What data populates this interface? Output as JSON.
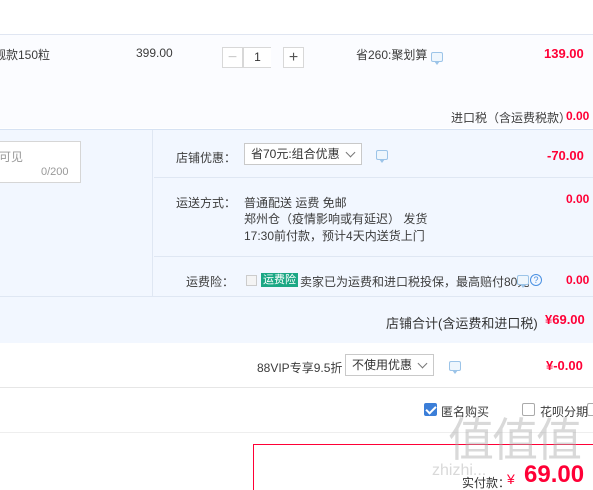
{
  "item": {
    "title_partial": "靓款150粒",
    "unit_price": "399.00",
    "quantity": "1",
    "minus_label": "−",
    "plus_label": "+",
    "savings": "省260:聚划算",
    "subtotal": "139.00",
    "import_tax_label": "进口税（含运费税款）",
    "import_tax_value": "0.00"
  },
  "memo": {
    "placeholder_partial": "可见",
    "counter": "0/200"
  },
  "store": {
    "discount_label": "店铺优惠：",
    "discount_select": "省70元:组合优惠",
    "discount_value": "-70.00",
    "shipping_label": "运送方式：",
    "shipping_line1": "普通配送 运费 免邮",
    "shipping_line2": "郑州仓（疫情影响或有延迟）  发货",
    "shipping_line3": "17:30前付款，预计4天内送货上门",
    "shipping_value": "0.00",
    "insurance_label": "运费险：",
    "insurance_badge": "运费险",
    "insurance_text": "卖家已为运费和进口税投保，最高赔付80元",
    "insurance_value": "0.00",
    "total_label": "店铺合计(含运费和进口税)",
    "total_value": "¥69.00"
  },
  "vip": {
    "label": "88VIP专享9.5折",
    "select": "不使用优惠",
    "value": "¥-0.00"
  },
  "options": {
    "anonymous": "匿名购买",
    "huabei": "花呗分期"
  },
  "payment": {
    "label": "实付款：",
    "currency": "¥",
    "amount": "69.00"
  },
  "watermark": {
    "logo": "值值值",
    "url": "zhizhi..."
  },
  "colors": {
    "accent_red": "#ff0036",
    "panel_blue": "#f2f7ff",
    "badge_green": "#1ba784",
    "checkbox_blue": "#3b7ed8"
  }
}
